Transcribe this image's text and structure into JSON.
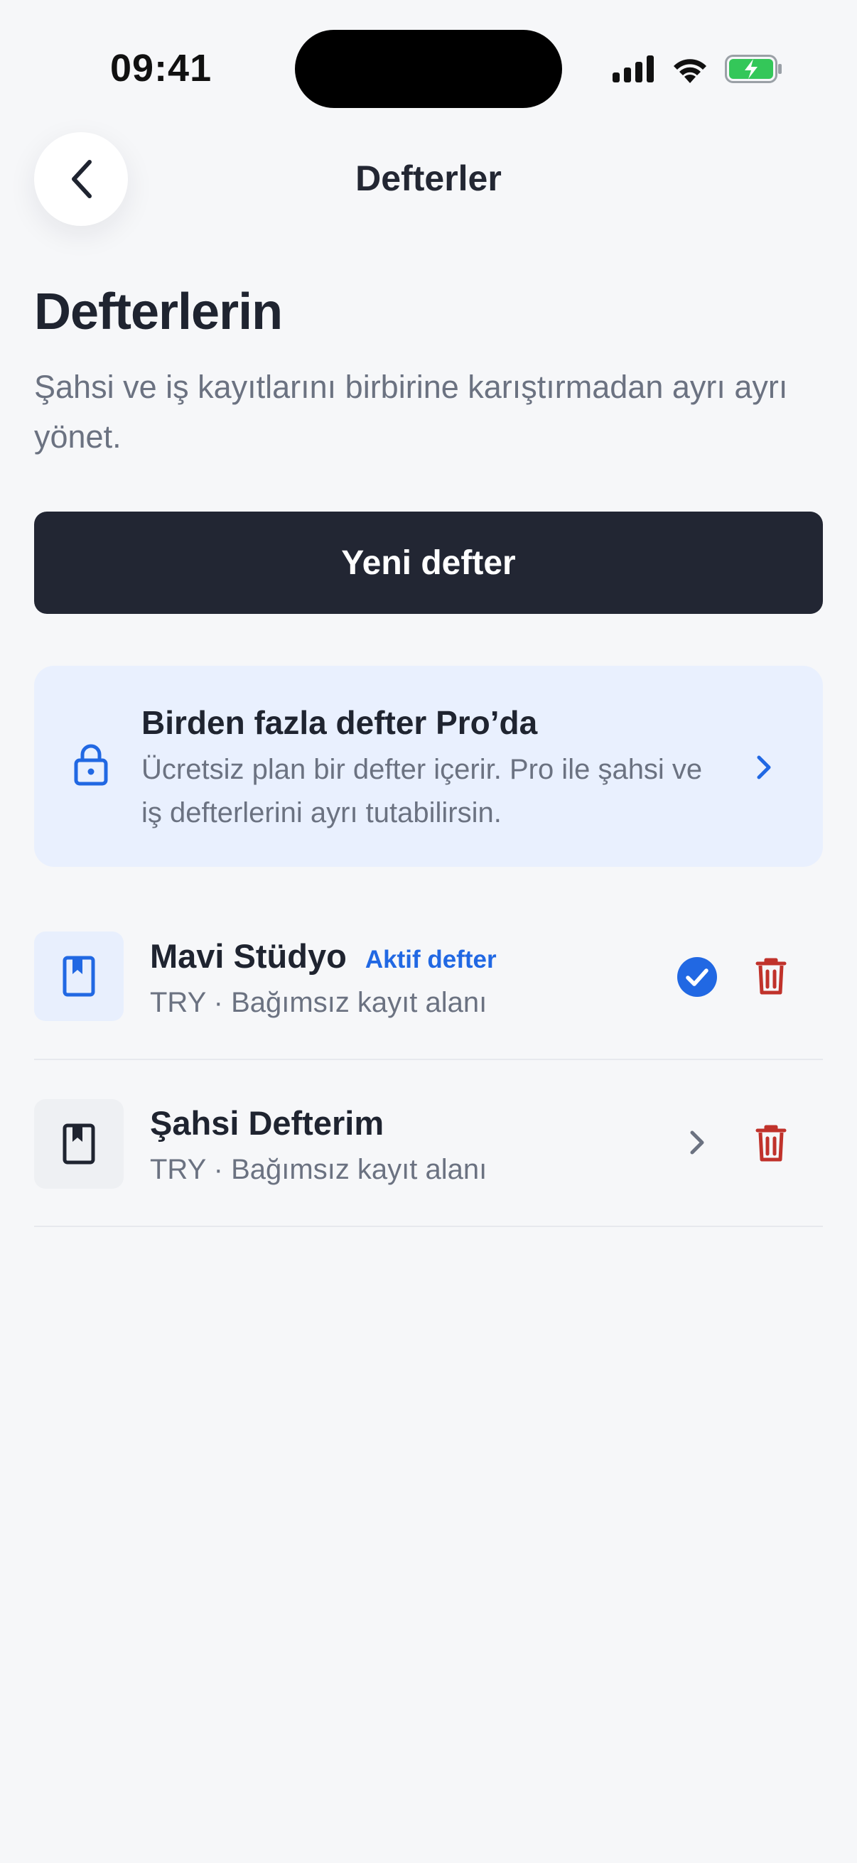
{
  "status_bar": {
    "time": "09:41"
  },
  "nav": {
    "title": "Defterler"
  },
  "header": {
    "title": "Defterlerin",
    "subtitle": "Şahsi ve iş kayıtlarını birbirine karıştırmadan ayrı ayrı yönet."
  },
  "actions": {
    "new_label": "Yeni defter"
  },
  "pro_banner": {
    "title": "Birden fazla defter Pro’da",
    "description": "Ücretsiz plan bir defter içerir. Pro ile şahsi ve iş defterlerini ayrı tutabilirsin."
  },
  "ledgers": [
    {
      "name": "Mavi Stüdyo",
      "badge": "Aktif defter",
      "meta": "TRY · Bağımsız kayıt alanı",
      "active": true
    },
    {
      "name": "Şahsi Defterim",
      "badge": "",
      "meta": "TRY · Bağımsız kayıt alanı",
      "active": false
    }
  ],
  "colors": {
    "accent": "#2168e3",
    "danger": "#c0322b",
    "primary_button": "#222633",
    "background": "#f6f7f9",
    "pro_banner_bg": "#e9f0fe",
    "battery": "#34c759"
  },
  "icons": {
    "back": "chevron-left-icon",
    "lock": "lock-icon",
    "ledger": "bookmark-book-icon",
    "active": "check-circle-icon",
    "open": "chevron-right-icon",
    "delete": "trash-icon"
  }
}
